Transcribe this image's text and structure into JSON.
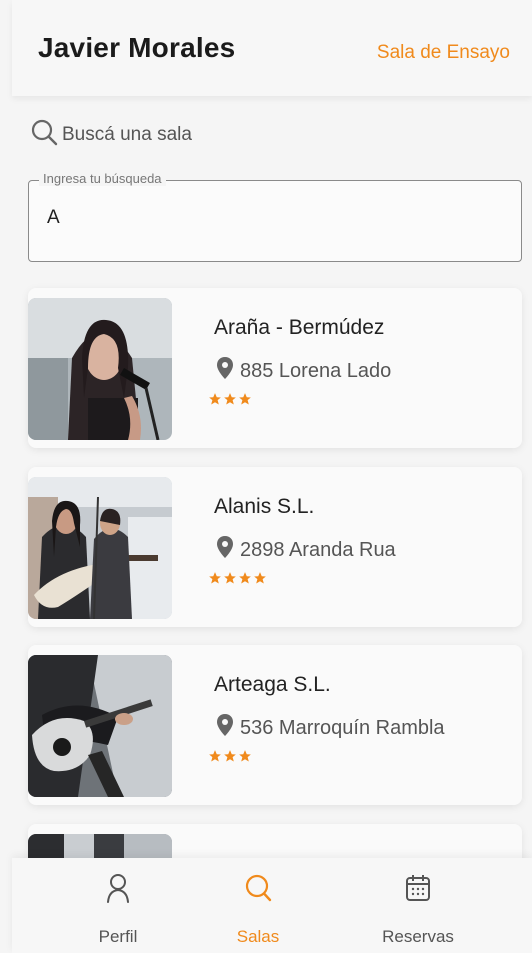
{
  "header": {
    "user_name": "Javier Morales",
    "link": "Sala de Ensayo"
  },
  "search": {
    "label": "Buscá una sala",
    "field_legend": "Ingresa tu búsqueda",
    "value": "A"
  },
  "rooms": [
    {
      "name": "Araña - Bermúdez",
      "address": "885 Lorena Lado",
      "stars": 3
    },
    {
      "name": "Alanis S.L.",
      "address": "2898 Aranda Rua",
      "stars": 4
    },
    {
      "name": "Arteaga S.L.",
      "address": "536 Marroquín Rambla",
      "stars": 3
    }
  ],
  "nav": {
    "items": [
      {
        "label": "Perfil",
        "icon": "person-icon"
      },
      {
        "label": "Salas",
        "icon": "search-icon",
        "active": true
      },
      {
        "label": "Reservas",
        "icon": "calendar-icon"
      }
    ]
  },
  "colors": {
    "accent": "#f08a1c",
    "star": "#f08a1c"
  }
}
